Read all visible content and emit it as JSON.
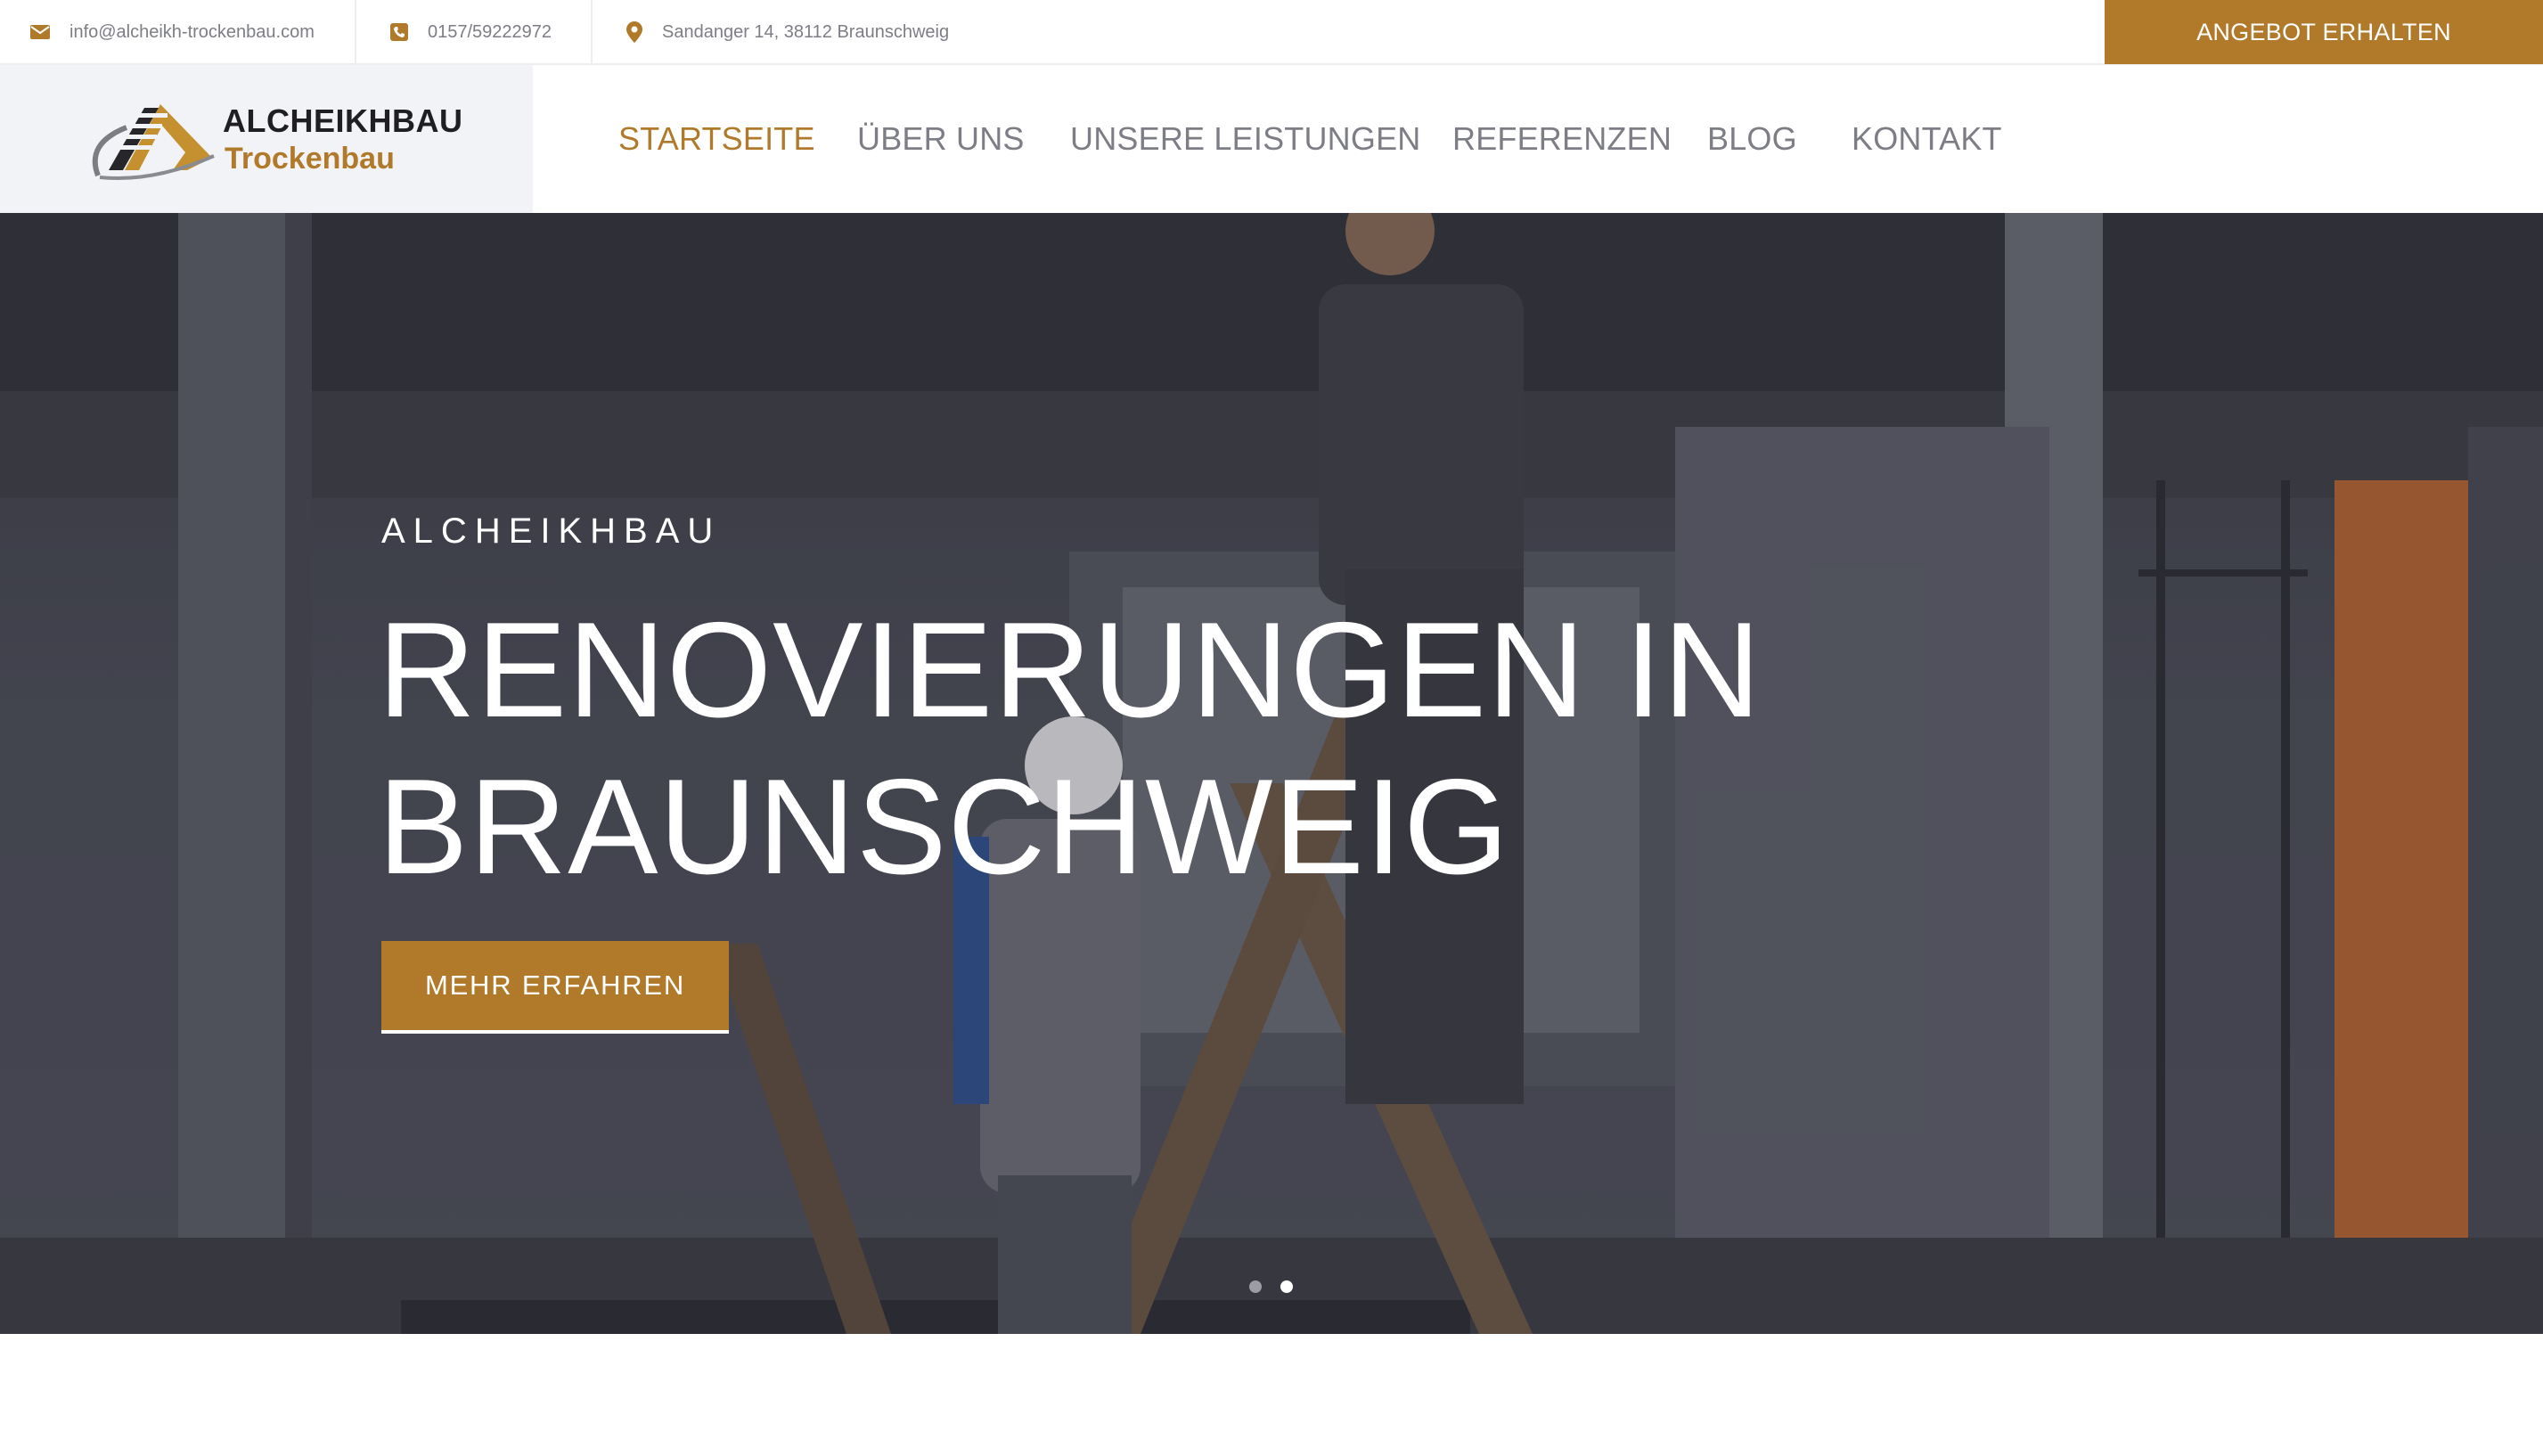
{
  "topbar": {
    "email": "info@alcheikh-trockenbau.com",
    "phone": "0157/59222972",
    "address": "Sandanger 14, 38112 Braunschweig",
    "cta_label": "ANGEBOT ERHALTEN"
  },
  "header": {
    "logo_line1": "ALCHEIKHBAU",
    "logo_line2": "Trockenbau",
    "nav": [
      {
        "label": "STARTSEITE",
        "active": true
      },
      {
        "label": "ÜBER UNS"
      },
      {
        "label": "UNSERE LEISTUNGEN"
      },
      {
        "label": "REFERENZEN"
      },
      {
        "label": "BLOG"
      },
      {
        "label": "KONTAKT"
      }
    ]
  },
  "hero": {
    "kicker": "ALCHEIKHBAU",
    "title_line1": "RENOVIERUNGEN IN",
    "title_line2": "BRAUNSCHWEIG",
    "button_label": "MEHR ERFAHREN",
    "slides_total": 2,
    "active_slide": 2
  },
  "colors": {
    "accent": "#b07a2a",
    "nav_text": "#7d7e85",
    "logo_bg": "#f2f3f6"
  },
  "icons": {
    "email": "envelope-icon",
    "phone": "phone-icon",
    "address": "map-pin-icon"
  }
}
